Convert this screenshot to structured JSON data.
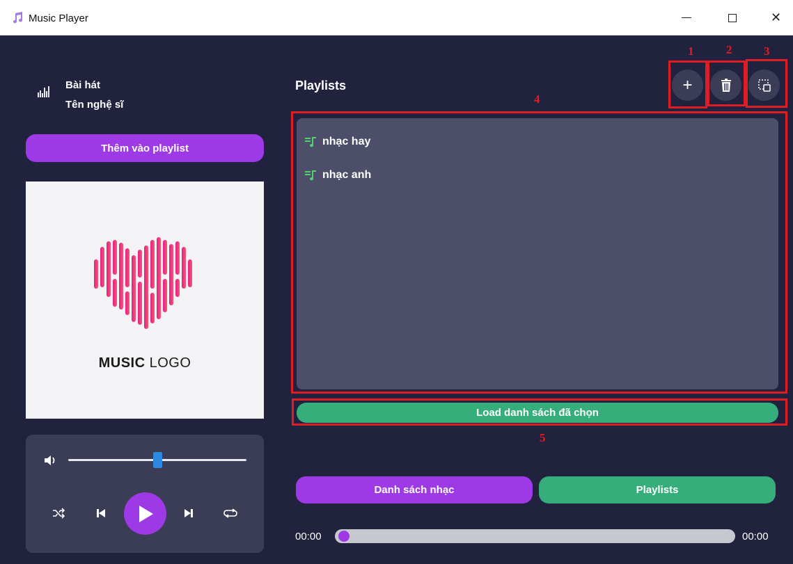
{
  "window": {
    "title": "Music Player",
    "minimize_label": "",
    "close_label": "✕"
  },
  "now_playing": {
    "song": "Bài hát",
    "artist": "Tên nghệ sĩ"
  },
  "actions": {
    "add_to_playlist": "Thêm vào playlist"
  },
  "cover": {
    "logo_bold": "MUSIC",
    "logo_light": " LOGO",
    "gradient_colors": [
      "#e61e8c",
      "#f35a6e"
    ]
  },
  "player": {
    "volume_level": 0.5,
    "progress": 0.0,
    "current_time": "00:00",
    "total_time": "00:00",
    "icons": [
      "volume-icon",
      "shuffle-icon",
      "previous-icon",
      "play-icon",
      "next-icon",
      "repeat-icon"
    ]
  },
  "playlists_panel": {
    "heading": "Playlists",
    "buttons": {
      "add": "+",
      "delete_icon": "trash-icon",
      "select_icon": "select-icon"
    },
    "items": [
      {
        "label": "nhạc hay"
      },
      {
        "label": "nhạc anh"
      }
    ],
    "load_button": "Load danh sách đã chọn"
  },
  "tabs": {
    "songs": "Danh sách nhạc",
    "playlists": "Playlists"
  },
  "annotations": [
    "1",
    "2",
    "3",
    "4",
    "5"
  ],
  "colors": {
    "background": "#21223d",
    "purple": "#9d3ae5",
    "green": "#36ae7c",
    "panel": "#4d4e69",
    "annotation": "#e01d24"
  }
}
